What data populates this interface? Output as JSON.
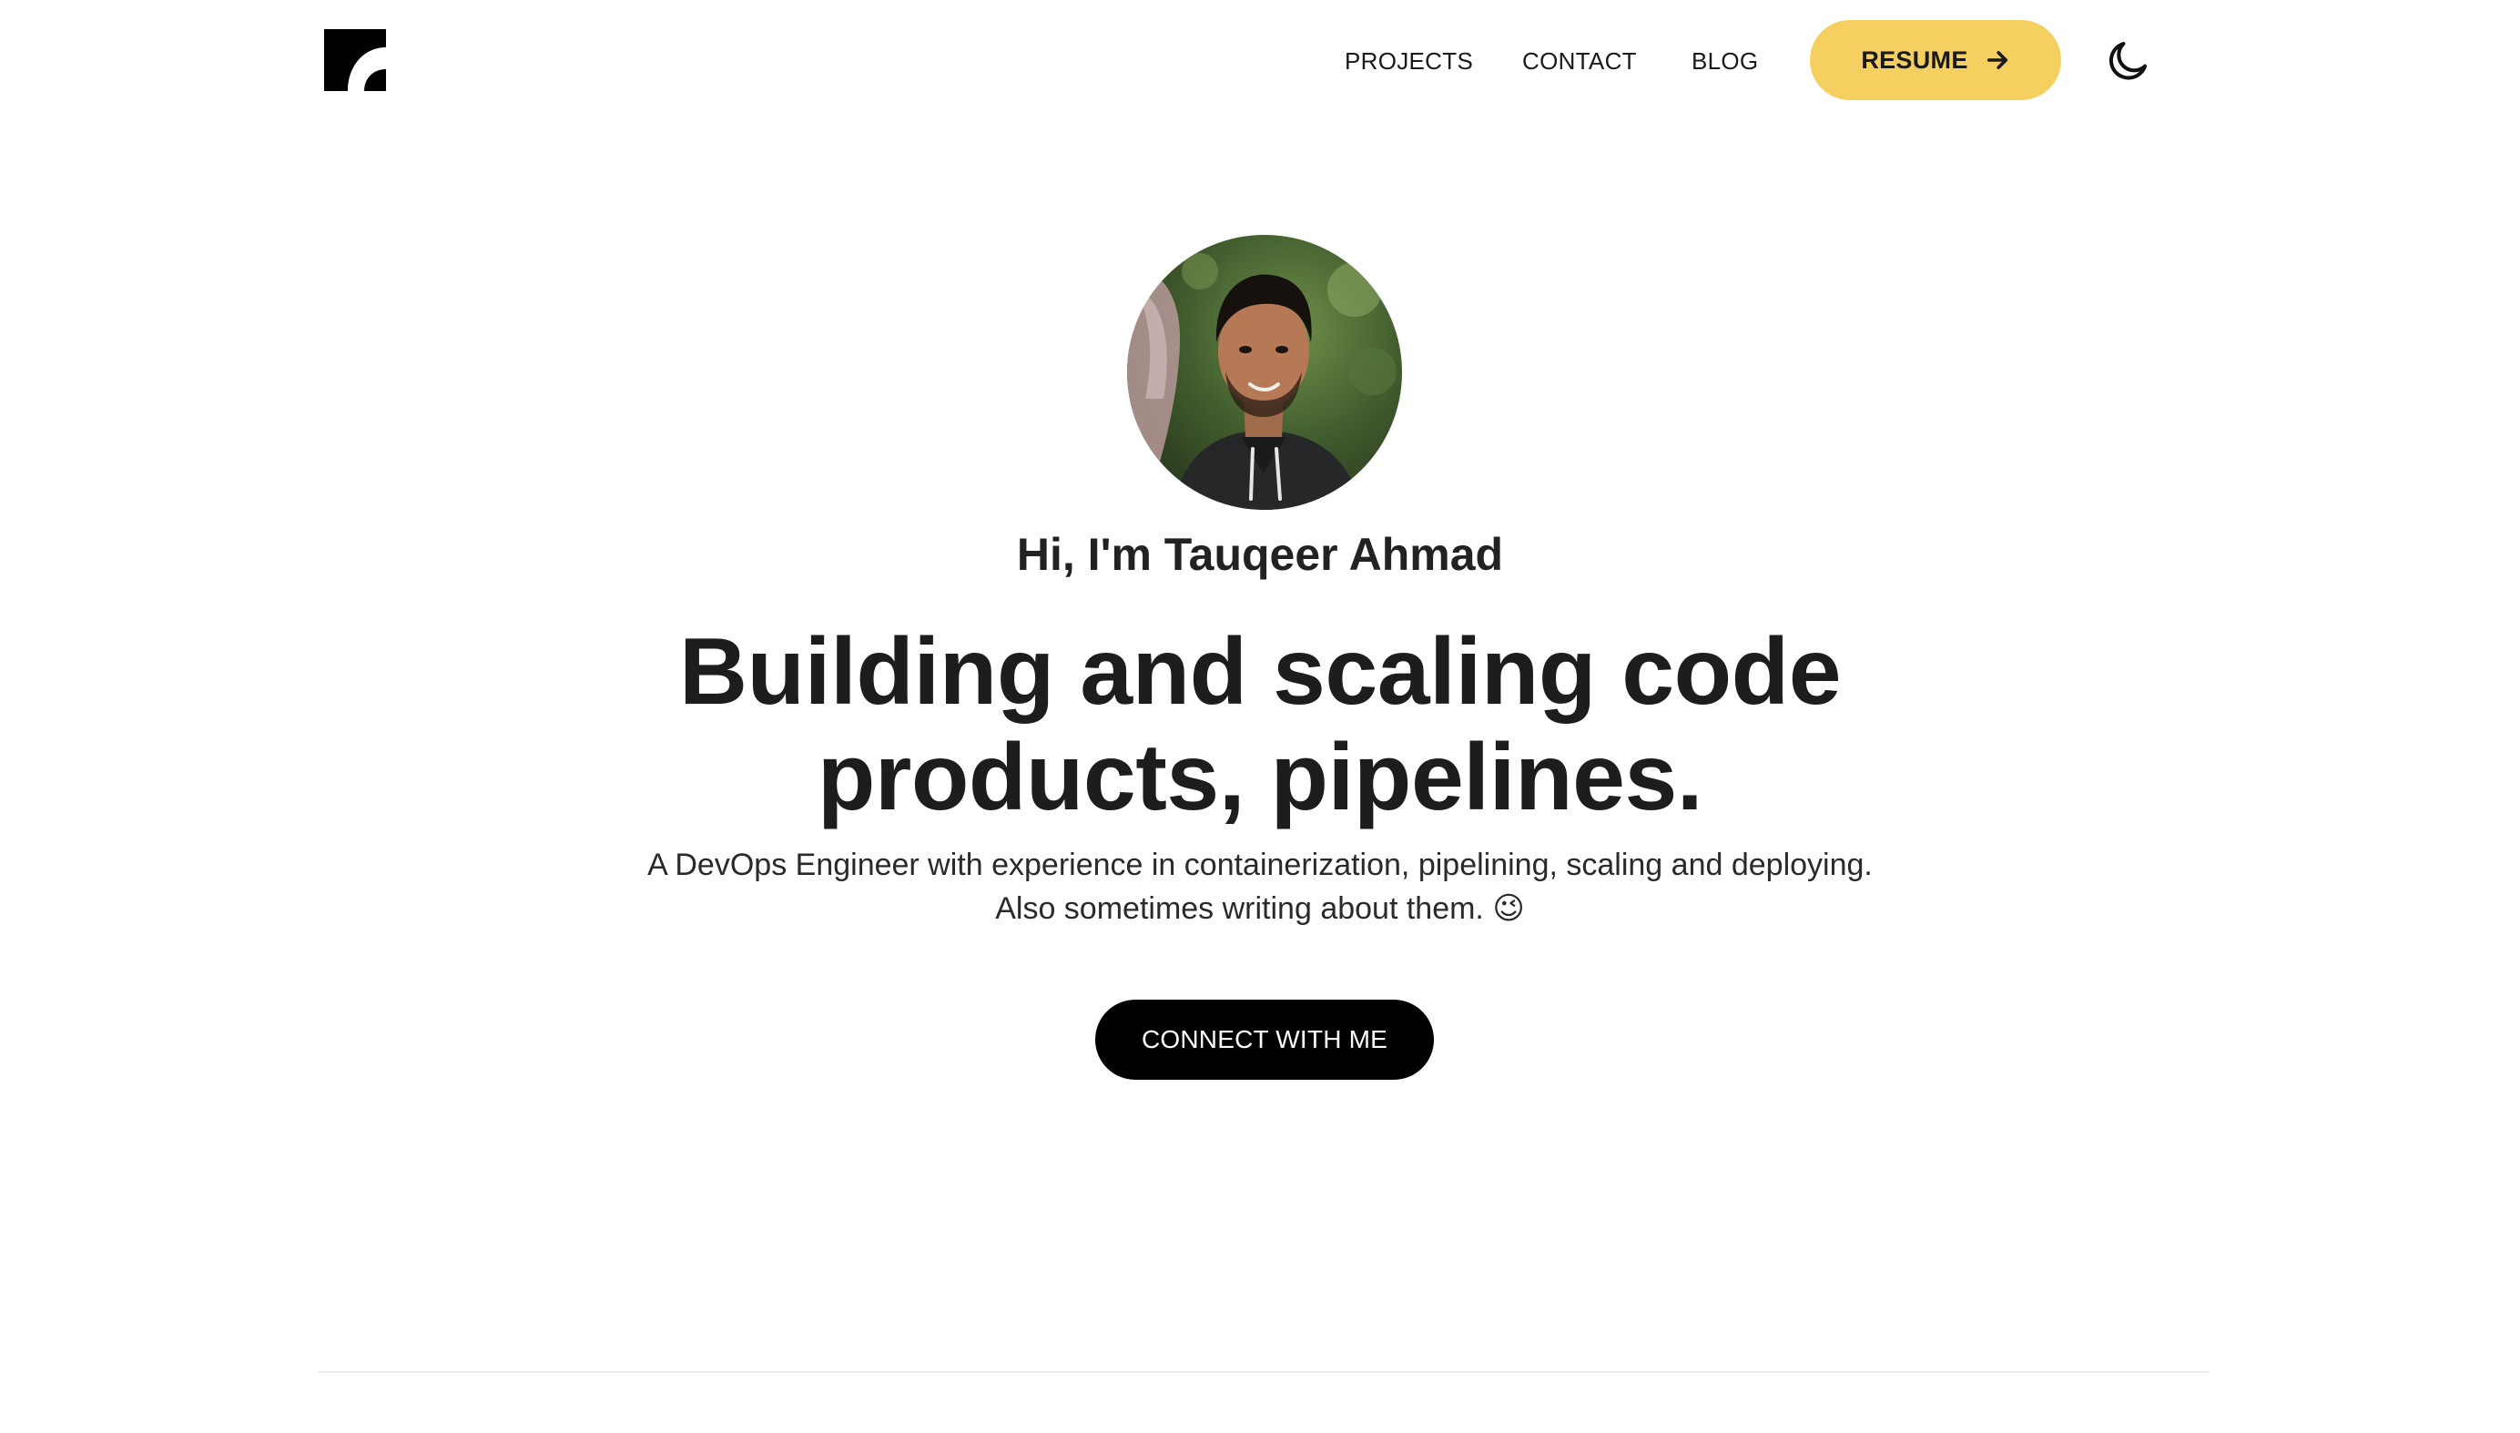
{
  "header": {
    "logo_icon": "site-logo-icon",
    "nav": {
      "projects": "PROJECTS",
      "contact": "CONTACT",
      "blog": "BLOG"
    },
    "resume_label": "RESUME",
    "resume_icon": "arrow-right-icon",
    "theme_toggle_icon": "moon-icon"
  },
  "hero": {
    "greeting": "Hi, I'm Tauqeer Ahmad",
    "headline_line1": "Building and scaling code",
    "headline_line2": "products, pipelines.",
    "subtitle_line1": "A DevOps Engineer with experience in containerization, pipelining, scaling and deploying.",
    "subtitle_line2": "Also sometimes writing about them. 😉",
    "cta_label": "CONNECT WITH ME"
  },
  "colors": {
    "accent": "#f5d061",
    "cta_background": "#000000",
    "text": "#1f1f1f",
    "divider": "#ececec"
  }
}
